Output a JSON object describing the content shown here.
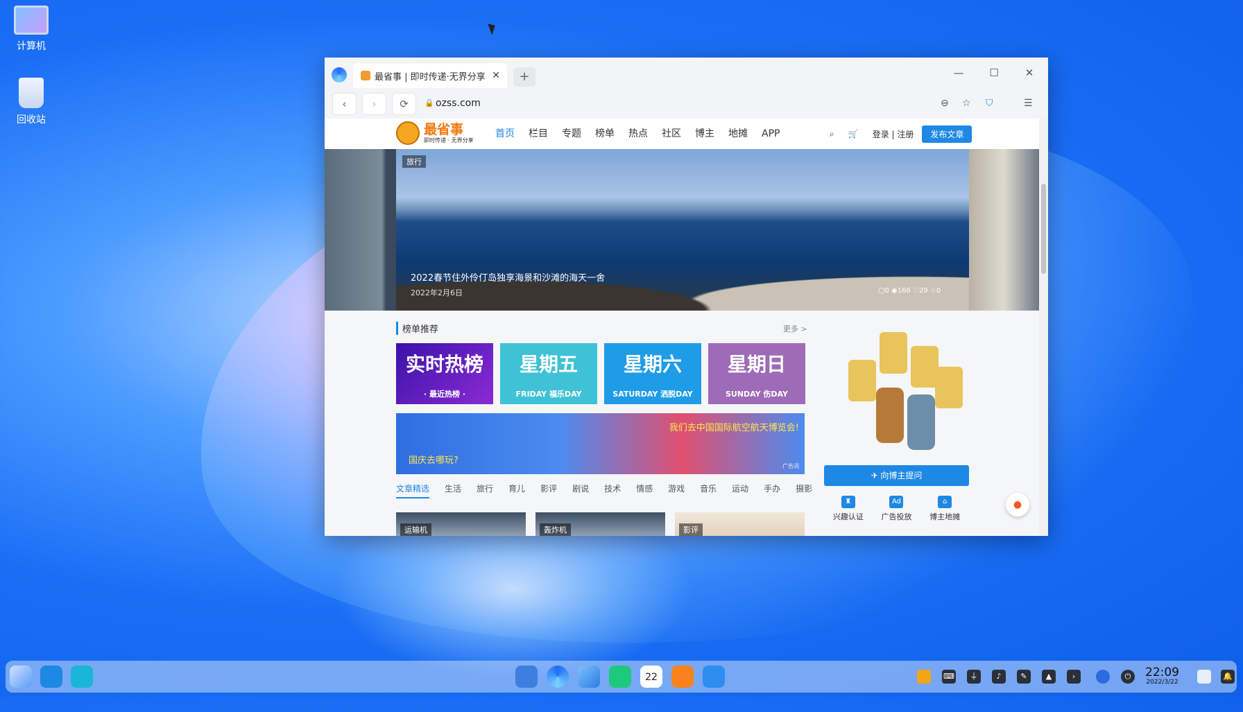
{
  "desktop": {
    "icons": [
      {
        "label": "计算机"
      },
      {
        "label": "回收站"
      }
    ]
  },
  "browser": {
    "tab_title": "最省事 | 即时传递·无界分享",
    "tab_close": "✕",
    "new_tab": "+",
    "url": "ozss.com",
    "controls": {
      "minimize": "—",
      "maximize": "☐",
      "close": "✕"
    }
  },
  "site": {
    "logo_main": "最省事",
    "logo_sub": "即时传递 · 无界分享",
    "menu": [
      "首页",
      "栏目",
      "专题",
      "榜单",
      "热点",
      "社区",
      "博主",
      "地摊",
      "APP"
    ],
    "login": "登录 | 注册",
    "publish": "发布文章",
    "hero": {
      "tag": "旅行",
      "title": "2022春节住外伶仃岛独享海景和沙滩的海天一舍",
      "date": "2022年2月6日",
      "stats": "▢0  ◉166  ♡29  ☆0"
    },
    "rank_section": {
      "title": "榜单推荐",
      "more": "更多 >"
    },
    "rank_cards": [
      {
        "title": "实时热榜",
        "sub": "· 最近热榜 ·",
        "color": "#5b1fb8"
      },
      {
        "title": "星期五",
        "sub": "FRIDAY 福乐DAY",
        "color": "#3fc2d6"
      },
      {
        "title": "星期六",
        "sub": "SATURDAY 洒脱DAY",
        "color": "#1f9ce8"
      },
      {
        "title": "星期日",
        "sub": "SUNDAY 伤DAY",
        "color": "#9d6bb7"
      }
    ],
    "banner": {
      "headline": "我们去中国国际航空航天博览会!",
      "question": "国庆去哪玩?",
      "ad_mark": "广告词"
    },
    "categories": [
      "文章精选",
      "生活",
      "旅行",
      "育儿",
      "影评",
      "剧说",
      "技术",
      "情感",
      "游戏",
      "音乐",
      "运动",
      "手办",
      "摄影"
    ],
    "thumbnails": [
      "运输机",
      "轰炸机",
      "影评"
    ],
    "sidebar": {
      "ask_button": "✈ 向博主提问",
      "links": [
        {
          "label": "兴趣认证",
          "icon": "castle-icon"
        },
        {
          "label": "广告投放",
          "icon": "ad-icon"
        },
        {
          "label": "博主地摊",
          "icon": "basket-icon"
        }
      ]
    }
  },
  "taskbar": {
    "time": "22:09",
    "date": "2022/3/22",
    "calendar_day": "22"
  }
}
